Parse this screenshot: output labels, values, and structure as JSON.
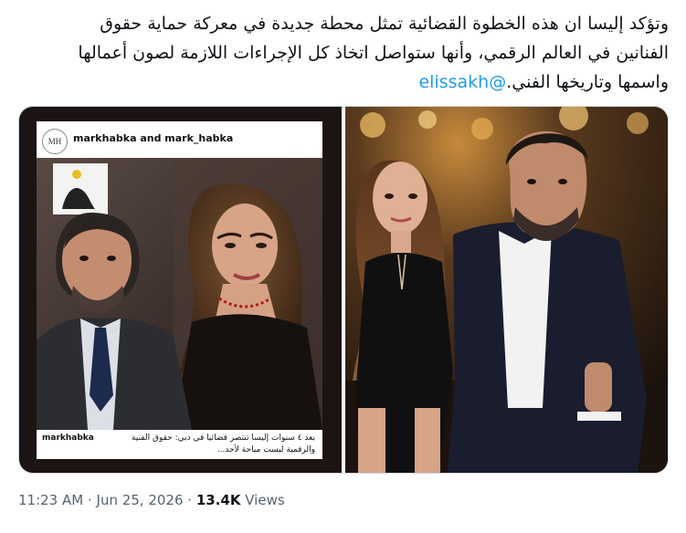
{
  "tweet": {
    "text_line1": "وتؤكد إليسا ان هذه الخطوة القضائية تمثل محطة جديدة في معركة حماية حقوق",
    "text_line2": "الفنانين في العالم الرقمي، وأنها ستواصل اتخاذ كل الإجراءات اللازمة لصون أعمالها",
    "text_line3": "واسمها وتاريخها الفني.",
    "mention": "@elissakh"
  },
  "media_left": {
    "avatar_initials": "MH",
    "header_user": "markhabka and mark_habka",
    "caption_user": "markhabka",
    "caption_text": "بعد ٤ سنوات إليسا تنتصر قضائيا في دبي: حقوق الفنية والرقمية ليست مباحة لأحد..."
  },
  "meta": {
    "time": "11:23 AM",
    "sep1": " · ",
    "date": "Jun 25, 2026",
    "sep2": " · ",
    "views_count": "13.4K",
    "views_label": " Views"
  },
  "colors": {
    "link": "#1d9bf0",
    "text": "#0f1419",
    "muted": "#536471",
    "border": "#cfd9de"
  }
}
